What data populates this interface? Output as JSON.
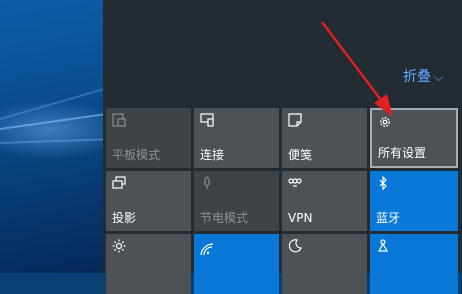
{
  "action_center": {
    "collapse_label": "折叠",
    "tiles": [
      {
        "label": "平板模式",
        "icon": "tablet-mode-icon",
        "state": "disabled"
      },
      {
        "label": "连接",
        "icon": "connect-icon",
        "state": "normal"
      },
      {
        "label": "便笺",
        "icon": "note-icon",
        "state": "normal"
      },
      {
        "label": "所有设置",
        "icon": "gear-icon",
        "state": "selected"
      },
      {
        "label": "投影",
        "icon": "project-icon",
        "state": "normal"
      },
      {
        "label": "节电模式",
        "icon": "battery-saver-icon",
        "state": "disabled"
      },
      {
        "label": "VPN",
        "icon": "vpn-icon",
        "state": "normal"
      },
      {
        "label": "蓝牙",
        "icon": "bluetooth-icon",
        "state": "active"
      },
      {
        "label": "",
        "icon": "brightness-icon",
        "state": "normal"
      },
      {
        "label": "",
        "icon": "wifi-icon",
        "state": "active"
      },
      {
        "label": "",
        "icon": "quiet-hours-icon",
        "state": "normal"
      },
      {
        "label": "",
        "icon": "location-icon",
        "state": "active"
      }
    ]
  },
  "colors": {
    "panel_bg": "#232b33",
    "tile_normal": "#4c5256",
    "tile_active": "#0a78d7",
    "accent_link": "#5fa7ff",
    "arrow": "#e02020"
  }
}
